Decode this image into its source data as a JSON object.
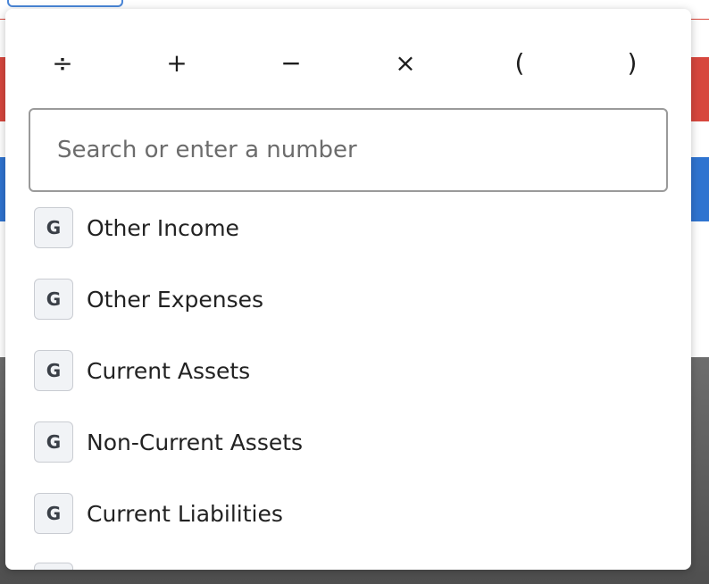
{
  "operators": [
    {
      "symbol": "÷",
      "name": "divide"
    },
    {
      "symbol": "+",
      "name": "plus"
    },
    {
      "symbol": "−",
      "name": "minus"
    },
    {
      "symbol": "×",
      "name": "multiply"
    },
    {
      "symbol": "(",
      "name": "open-paren"
    },
    {
      "symbol": ")",
      "name": "close-paren"
    }
  ],
  "search": {
    "placeholder": "Search or enter a number",
    "value": ""
  },
  "items": [
    {
      "badge": "G",
      "label": "Other Income"
    },
    {
      "badge": "G",
      "label": "Other Expenses"
    },
    {
      "badge": "G",
      "label": "Current Assets"
    },
    {
      "badge": "G",
      "label": "Non-Current Assets"
    },
    {
      "badge": "G",
      "label": "Current Liabilities"
    }
  ],
  "colors": {
    "red_band": "#d7473e",
    "blue_band": "#2f74d0",
    "focus_border": "#4a86d8"
  }
}
